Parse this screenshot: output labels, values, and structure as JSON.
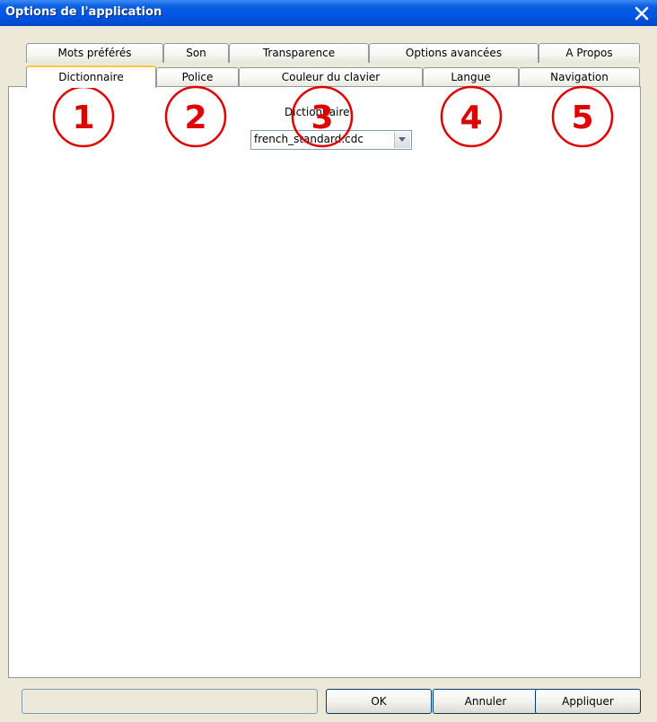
{
  "window": {
    "title": "Options de l'application"
  },
  "tabs_row1": [
    "Mots préférés",
    "Son",
    "Transparence",
    "Options avancées",
    "A Propos"
  ],
  "tabs_row2": [
    "Dictionnaire",
    "Police",
    "Couleur du clavier",
    "Langue",
    "Navigation"
  ],
  "active_tab": "Dictionnaire",
  "dictionary": {
    "label": "Dictionnaire",
    "selected": "french_standard.cdc"
  },
  "annotations": [
    "1",
    "2",
    "3",
    "4",
    "5"
  ],
  "annotation_color": "#e00000",
  "buttons": {
    "ok": "OK",
    "cancel": "Annuler",
    "apply": "Appliquer"
  },
  "colors": {
    "titlebar": "#0055e5",
    "window_bg": "#ece9d8",
    "active_tab_accent": "#ffc83c"
  }
}
